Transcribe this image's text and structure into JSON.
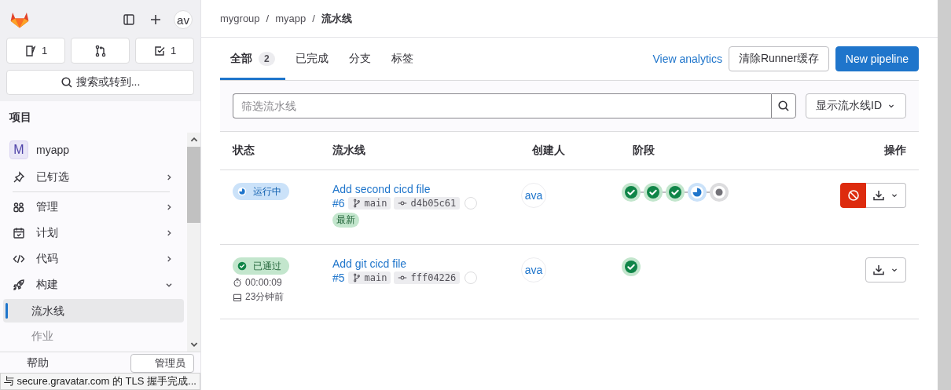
{
  "sidebar": {
    "avatar": "av",
    "counters": [
      {
        "kind": "issue",
        "count": "1"
      },
      {
        "kind": "merge"
      },
      {
        "kind": "todo",
        "count": "1"
      }
    ],
    "search": "搜索或转到...",
    "section_title": "项目",
    "project": {
      "initial": "M",
      "name": "myapp"
    },
    "items": [
      {
        "kind": "pin",
        "label": "已钉选",
        "expanded": false,
        "divider": true
      },
      {
        "kind": "manage",
        "label": "管理",
        "expanded": false
      },
      {
        "kind": "plan",
        "label": "计划",
        "expanded": false
      },
      {
        "kind": "code",
        "label": "代码",
        "expanded": false
      },
      {
        "kind": "build",
        "label": "构建",
        "expanded": true,
        "children": [
          {
            "label": "流水线",
            "selected": true
          },
          {
            "label": "作业",
            "selected": false
          }
        ]
      }
    ],
    "help": "帮助",
    "admin": "管理员"
  },
  "status_bar": "与 secure.gravatar.com 的 TLS 握手完成...",
  "breadcrumb": [
    {
      "kind": "link",
      "text": "mygroup"
    },
    {
      "kind": "separator",
      "text": "/"
    },
    {
      "kind": "link",
      "text": "myapp"
    },
    {
      "kind": "separator",
      "text": "/"
    },
    {
      "kind": "current",
      "text": "流水线"
    }
  ],
  "tabs": [
    {
      "label": "全部",
      "count": "2",
      "selected": true
    },
    {
      "label": "已完成",
      "selected": false
    },
    {
      "label": "分支",
      "selected": false
    },
    {
      "label": "标签",
      "selected": false
    }
  ],
  "header_actions": {
    "analytics": "View analytics",
    "clear_cache": "清除Runner缓存",
    "new_pipeline": "New pipeline"
  },
  "filter": {
    "placeholder": "筛选流水线",
    "display_dropdown": "显示流水线ID"
  },
  "table": {
    "columns": [
      "状态",
      "流水线",
      "创建人",
      "阶段",
      "操作"
    ],
    "rows": [
      {
        "kind": "running",
        "status_label": "运行中",
        "title": "Add second cicd file",
        "id": "#6",
        "branch": "main",
        "commit": "d4b05c61",
        "latest": "最新",
        "creator": "ava",
        "stages": [
          {
            "kind": "success"
          },
          {
            "kind": "success"
          },
          {
            "kind": "success"
          },
          {
            "kind": "running"
          },
          {
            "kind": "created"
          }
        ],
        "cancelable": true
      },
      {
        "kind": "success",
        "status_label": "已通过",
        "duration": "00:00:09",
        "finished": "23分钟前",
        "title": "Add git cicd file",
        "id": "#5",
        "branch": "main",
        "commit": "fff04226",
        "creator": "ava",
        "stages": [
          {
            "kind": "success"
          }
        ],
        "cancelable": false
      }
    ]
  }
}
